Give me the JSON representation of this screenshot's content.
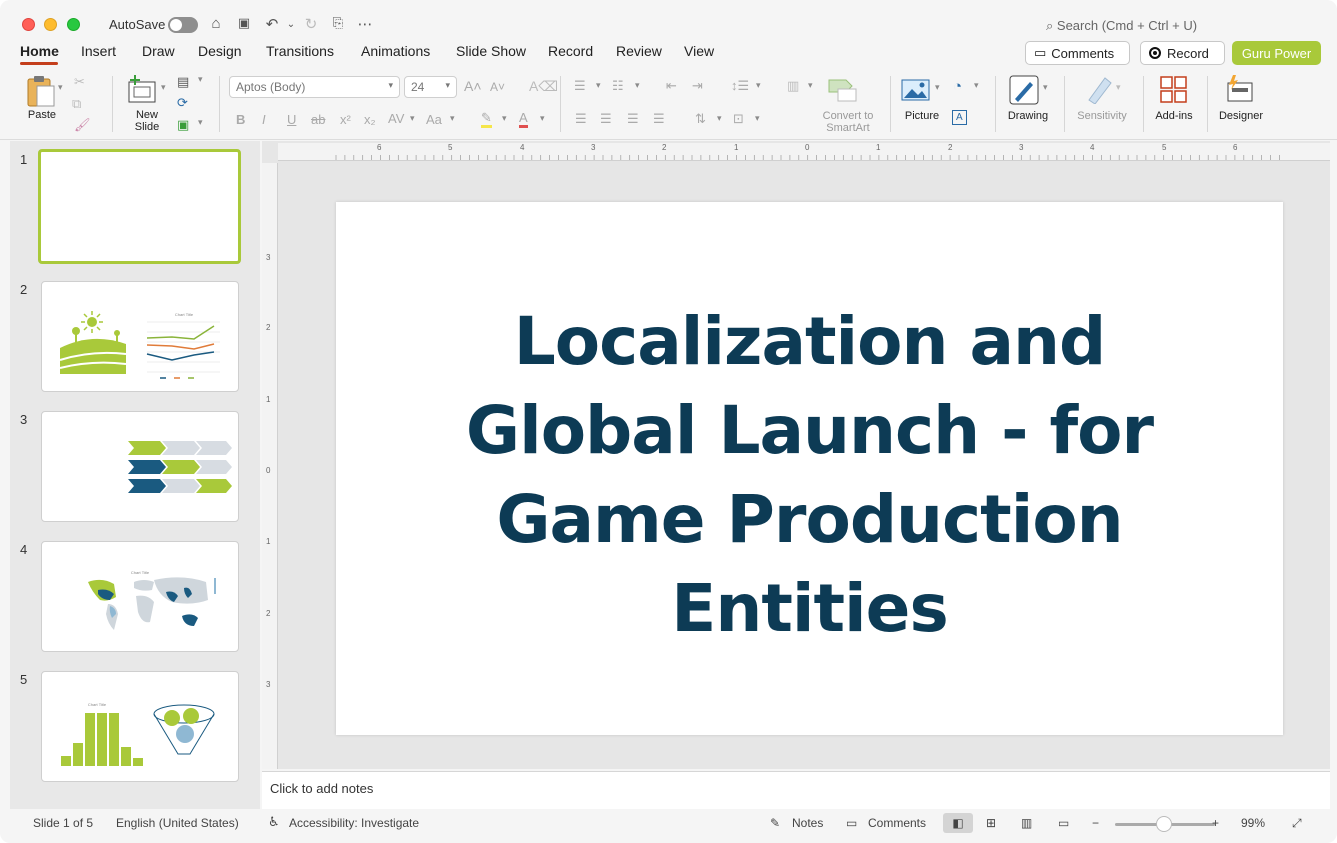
{
  "titlebar": {
    "autosave_label": "AutoSave",
    "search_placeholder": "Search (Cmd + Ctrl + U)"
  },
  "tabs": [
    "Home",
    "Insert",
    "Draw",
    "Design",
    "Transitions",
    "Animations",
    "Slide Show",
    "Record",
    "Review",
    "View"
  ],
  "header_buttons": {
    "comments": "Comments",
    "record": "Record",
    "guru": "Guru Power"
  },
  "ribbon": {
    "paste": "Paste",
    "new_slide_line1": "New",
    "new_slide_line2": "Slide",
    "font_name": "Aptos (Body)",
    "font_size": "24",
    "convert_line1": "Convert to",
    "convert_line2": "SmartArt",
    "picture": "Picture",
    "drawing": "Drawing",
    "sensitivity": "Sensitivity",
    "addins": "Add-ins",
    "designer": "Designer"
  },
  "slides": [
    "1",
    "2",
    "3",
    "4",
    "5"
  ],
  "thumb_chart_title": "Chart Title",
  "slide": {
    "title": "Localization and Global Launch - for Game Production Entities",
    "title_color": "#0d3b55"
  },
  "notes_placeholder": "Click to add notes",
  "status": {
    "slide_count": "Slide 1 of 5",
    "language": "English (United States)",
    "accessibility": "Accessibility: Investigate",
    "notes": "Notes",
    "comments": "Comments",
    "zoom": "99%"
  },
  "colors": {
    "accent_green": "#a9c93a",
    "accent_navy": "#1a5a80",
    "tab_underline": "#c43e1c"
  }
}
